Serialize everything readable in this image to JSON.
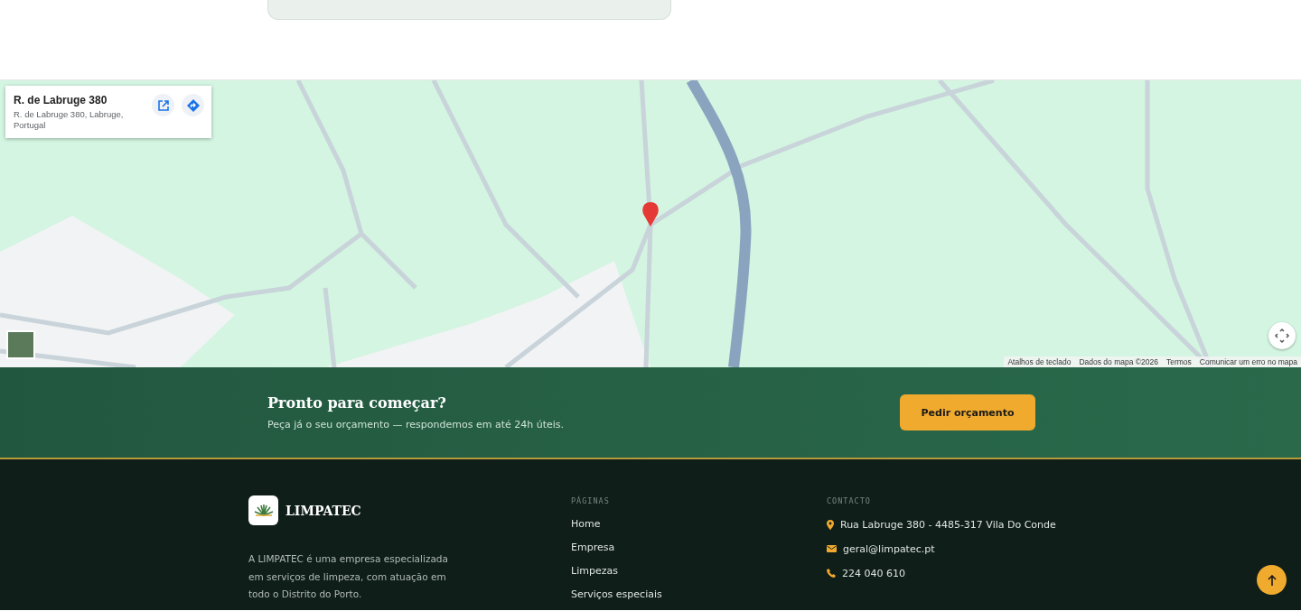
{
  "map": {
    "place_card": {
      "title": "R. de Labruge 380",
      "address": "R. de Labruge 380, Labruge, Portugal"
    },
    "attribution": [
      "Atalhos de teclado",
      "Dados do mapa ©2026",
      "Termos",
      "Comunicar um erro no mapa"
    ]
  },
  "cta": {
    "title": "Pronto para começar?",
    "text": "Peça já o seu orçamento — respondemos em até 24h úteis.",
    "button": "Pedir orçamento"
  },
  "footer": {
    "brand": "LIMPATEC",
    "description": "A LIMPATEC é uma empresa especializada em serviços de limpeza, com atuação em todo o Distrito do Porto.",
    "pages": {
      "heading": "PÁGINAS",
      "links": [
        "Home",
        "Empresa",
        "Limpezas",
        "Serviços especiais"
      ]
    },
    "contact": {
      "heading": "CONTACTO",
      "items": [
        {
          "kind": "address",
          "text": "Rua Labruge 380 - 4485-317 Vila Do Conde"
        },
        {
          "kind": "email",
          "text": "geral@limpatec.pt"
        },
        {
          "kind": "phone",
          "text": "224 040 610"
        }
      ]
    }
  }
}
